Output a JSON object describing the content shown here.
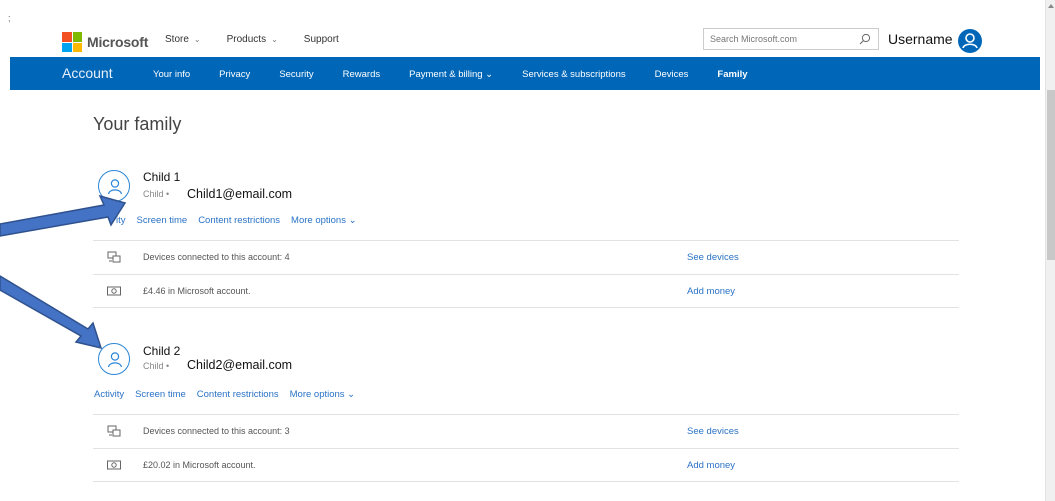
{
  "stray_mark": ";",
  "header": {
    "logo_text": "Microsoft",
    "nav": [
      {
        "label": "Store",
        "dropdown": true
      },
      {
        "label": "Products",
        "dropdown": true
      },
      {
        "label": "Support",
        "dropdown": false
      }
    ],
    "search_placeholder": "Search Microsoft.com",
    "username": "Username"
  },
  "account_nav": {
    "title": "Account",
    "links": [
      {
        "label": "Your info"
      },
      {
        "label": "Privacy"
      },
      {
        "label": "Security"
      },
      {
        "label": "Rewards"
      },
      {
        "label": "Payment & billing ⌄"
      },
      {
        "label": "Services & subscriptions"
      },
      {
        "label": "Devices"
      },
      {
        "label": "Family",
        "active": true
      }
    ]
  },
  "page_title": "Your family",
  "members": [
    {
      "name": "Child 1",
      "role": "Child  •",
      "email": "Child1@email.com",
      "links": [
        "ity",
        "Screen time",
        "Content restrictions",
        "More options ⌄"
      ],
      "devices_text": "Devices connected to this account: 4",
      "devices_link": "See devices",
      "money_text": "£4.46 in Microsoft account.",
      "money_link": "Add money"
    },
    {
      "name": "Child 2",
      "role": "Child  •",
      "email": "Child2@email.com",
      "links": [
        "Activity",
        "Screen time",
        "Content restrictions",
        "More options ⌄"
      ],
      "devices_text": "Devices connected to this account: 3",
      "devices_link": "See devices",
      "money_text": "£20.02 in Microsoft account.",
      "money_link": "Add money"
    }
  ],
  "colors": {
    "brand_blue": "#0067b8",
    "link_blue": "#2a72c5",
    "arrow_fill": "#4472c4",
    "arrow_stroke": "#2f528f"
  }
}
